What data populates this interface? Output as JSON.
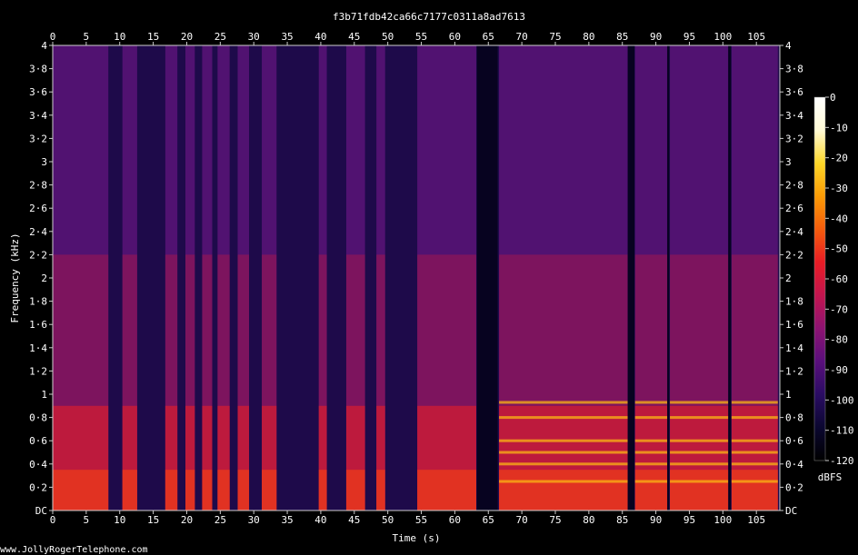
{
  "chart_data": {
    "type": "heatmap",
    "title": "f3b71fdb42ca66c7177c0311a8ad7613",
    "xlabel": "Time (s)",
    "ylabel": "Frequency (kHz)",
    "xlim": [
      0,
      108.5
    ],
    "ylim": [
      0,
      4
    ],
    "x_ticks": [
      "0",
      "5",
      "10",
      "15",
      "20",
      "25",
      "30",
      "35",
      "40",
      "45",
      "50",
      "55",
      "60",
      "65",
      "70",
      "75",
      "80",
      "85",
      "90",
      "95",
      "100",
      "105"
    ],
    "y_ticks": [
      "DC",
      "0·2",
      "0·4",
      "0·6",
      "0·8",
      "1",
      "1·2",
      "1·4",
      "1·6",
      "1·8",
      "2",
      "2·2",
      "2·4",
      "2·6",
      "2·8",
      "3",
      "3·2",
      "3·4",
      "3·6",
      "3·8",
      "4"
    ],
    "colorbar": {
      "label": "dBFS",
      "range": [
        -120,
        0
      ],
      "ticks": [
        "0",
        "-10",
        "-20",
        "-30",
        "-40",
        "-50",
        "-60",
        "-70",
        "-80",
        "-90",
        "-100",
        "-110",
        "-120"
      ],
      "colors": [
        "#000000",
        "#0b0730",
        "#2a0c63",
        "#5a0f7c",
        "#8d1372",
        "#c2154f",
        "#e81c25",
        "#f55c0c",
        "#fb9b05",
        "#fdd728",
        "#fffad6",
        "#ffffff"
      ]
    },
    "loud_segments_s": [
      [
        0,
        8.3
      ],
      [
        10.4,
        12.6
      ],
      [
        16.8,
        18.6
      ],
      [
        19.8,
        21.2
      ],
      [
        22.3,
        23.8
      ],
      [
        24.6,
        26.4
      ],
      [
        27.6,
        29.3
      ],
      [
        31.2,
        33.4
      ],
      [
        39.7,
        40.9
      ],
      [
        43.8,
        46.6
      ],
      [
        48.3,
        49.6
      ],
      [
        54.4,
        63.2
      ],
      [
        66.6,
        85.8
      ],
      [
        86.9,
        91.7
      ],
      [
        92.1,
        100.8
      ],
      [
        101.3,
        108.2
      ]
    ],
    "quiet_gaps_s": [
      [
        63.3,
        66.4
      ],
      [
        85.8,
        86.8
      ],
      [
        91.7,
        92.0
      ],
      [
        100.8,
        101.2
      ]
    ],
    "harmonic_peaks_khz": [
      0.25,
      0.4,
      0.5,
      0.6,
      0.8,
      0.93
    ]
  },
  "footer": {
    "credit": "www.JollyRogerTelephone.com"
  }
}
